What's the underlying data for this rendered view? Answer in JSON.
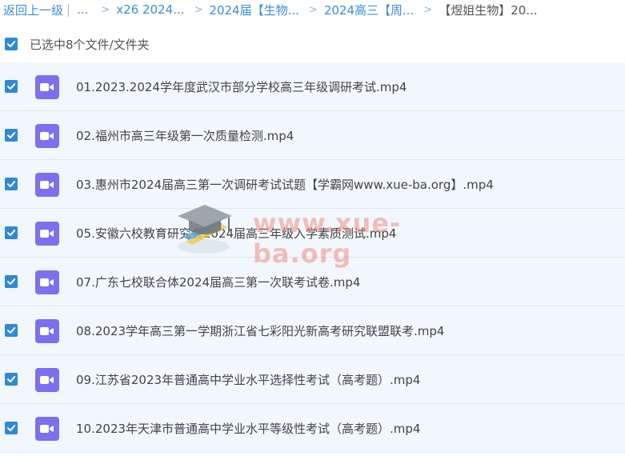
{
  "breadcrumb": {
    "back": "返回上一级",
    "ellipsis": "...",
    "items": [
      "x26 2024...",
      "2024届【生物...",
      "2024高三【周...",
      "【煜姐生物】20..."
    ]
  },
  "selection": {
    "label": "已选中8个文件/文件夹",
    "checked": true
  },
  "files": [
    {
      "name": "01.2023.2024学年度武汉市部分学校高三年级调研考试.mp4",
      "checked": true,
      "icon": "video-icon"
    },
    {
      "name": "02.福州市高三年级第一次质量检测.mp4",
      "checked": true,
      "icon": "video-icon"
    },
    {
      "name": "03.惠州市2024届高三第一次调研考试试题【学霸网www.xue-ba.org】.mp4",
      "checked": true,
      "icon": "video-icon"
    },
    {
      "name": "05.安徽六校教育研究会2024届高三年级入学素质测试.mp4",
      "checked": true,
      "icon": "video-icon"
    },
    {
      "name": "07.广东七校联合体2024届高三第一次联考试卷.mp4",
      "checked": true,
      "icon": "video-icon"
    },
    {
      "name": "08.2023学年高三第一学期浙江省七彩阳光新高考研究联盟联考.mp4",
      "checked": true,
      "icon": "video-icon"
    },
    {
      "name": "09.江苏省2023年普通高中学业水平选择性考试（高考题）.mp4",
      "checked": true,
      "icon": "video-icon"
    },
    {
      "name": "10.2023年天津市普通高中学业水平等级性考试（高考题）.mp4",
      "checked": true,
      "icon": "video-icon"
    }
  ],
  "watermark": {
    "text": "www.xue-ba.org",
    "icon": "graduation-cap-icon"
  },
  "colors": {
    "accent": "#2f89d8",
    "link": "#3b8cd9",
    "row_bg": "#f1f7fd",
    "file_icon": "#7c70f0"
  }
}
